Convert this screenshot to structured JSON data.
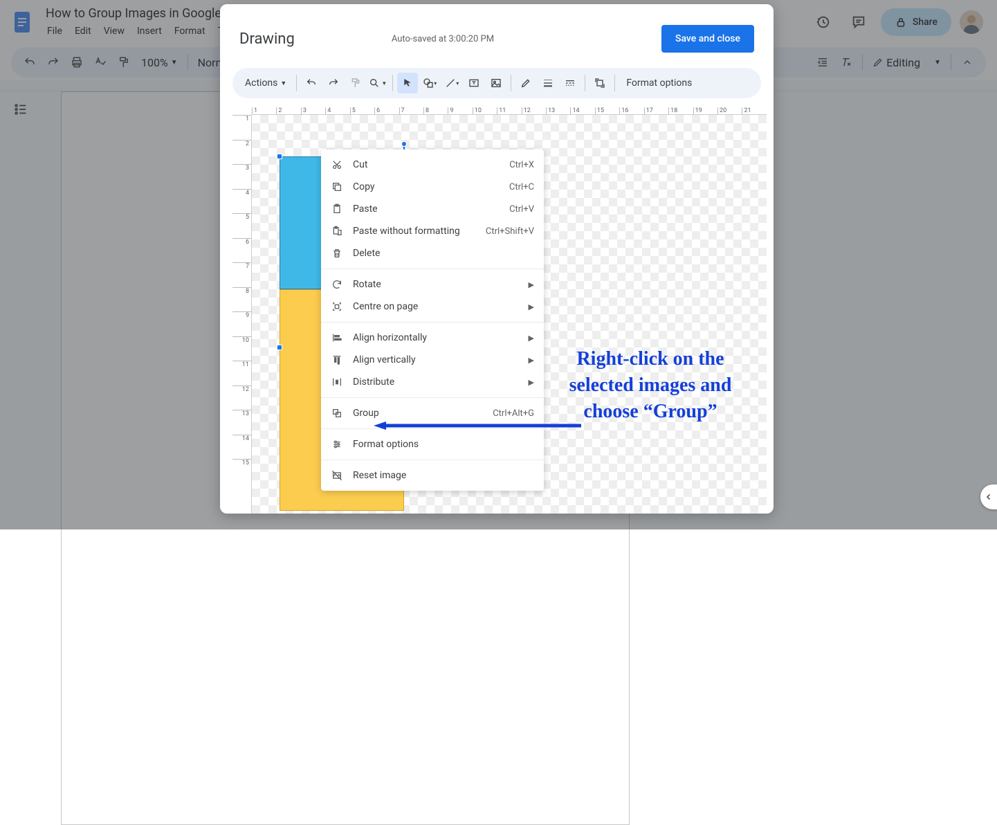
{
  "doc_title": "How to Group Images in Google Docs",
  "menus": [
    "File",
    "Edit",
    "View",
    "Insert",
    "Format",
    "To"
  ],
  "share_label": "Share",
  "toolbar": {
    "zoom": "100%",
    "style": "Norm",
    "editing": "Editing"
  },
  "modal": {
    "title": "Drawing",
    "saved": "Auto-saved at 3:00:20 PM",
    "save_close": "Save and close",
    "actions": "Actions",
    "format_options": "Format options"
  },
  "ruler_h": [
    "1",
    "2",
    "3",
    "4",
    "5",
    "6",
    "7",
    "8",
    "9",
    "10",
    "11",
    "12",
    "13",
    "14",
    "15",
    "16",
    "17",
    "18",
    "19",
    "20",
    "21"
  ],
  "ruler_v": [
    "1",
    "2",
    "3",
    "4",
    "5",
    "6",
    "7",
    "8",
    "9",
    "10",
    "11",
    "12",
    "13",
    "14",
    "15"
  ],
  "context": [
    {
      "icon": "cut",
      "label": "Cut",
      "sc": "Ctrl+X"
    },
    {
      "icon": "copy",
      "label": "Copy",
      "sc": "Ctrl+C"
    },
    {
      "icon": "paste",
      "label": "Paste",
      "sc": "Ctrl+V"
    },
    {
      "icon": "paste2",
      "label": "Paste without formatting",
      "sc": "Ctrl+Shift+V"
    },
    {
      "icon": "delete",
      "label": "Delete",
      "sc": ""
    },
    {
      "sep": true
    },
    {
      "icon": "rotate",
      "label": "Rotate",
      "arr": true
    },
    {
      "icon": "centre",
      "label": "Centre on page",
      "arr": true
    },
    {
      "sep": true
    },
    {
      "icon": "alignh",
      "label": "Align horizontally",
      "arr": true
    },
    {
      "icon": "alignv",
      "label": "Align vertically",
      "arr": true
    },
    {
      "icon": "dist",
      "label": "Distribute",
      "arr": true
    },
    {
      "sep": true
    },
    {
      "icon": "group",
      "label": "Group",
      "sc": "Ctrl+Alt+G"
    },
    {
      "sep": true
    },
    {
      "icon": "fopt",
      "label": "Format options",
      "sc": ""
    },
    {
      "sep": true
    },
    {
      "icon": "reset",
      "label": "Reset image",
      "sc": ""
    }
  ],
  "annotation": "Right-click on the selected images and choose “Group”"
}
